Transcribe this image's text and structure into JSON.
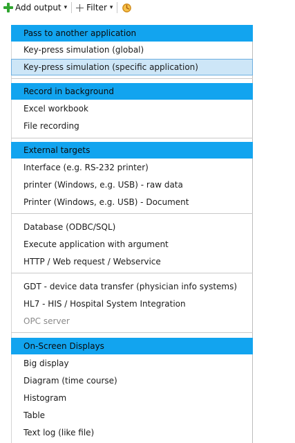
{
  "toolbar": {
    "add_output_label": "Add output",
    "filter_label": "Filter"
  },
  "menu": {
    "items": [
      {
        "label": "Pass to another application",
        "kind": "header"
      },
      {
        "label": "Key-press simulation (global)",
        "kind": "item"
      },
      {
        "label": "Key-press simulation (specific application)",
        "kind": "selected"
      },
      {
        "label": "Record in background",
        "kind": "header"
      },
      {
        "label": "Excel workbook",
        "kind": "item"
      },
      {
        "label": "File recording",
        "kind": "item"
      },
      {
        "label": "External targets",
        "kind": "header"
      },
      {
        "label": "Interface (e.g. RS-232 printer)",
        "kind": "item"
      },
      {
        "label": "printer (Windows, e.g. USB) - raw data",
        "kind": "item"
      },
      {
        "label": "Printer (Windows, e.g. USB) - Document",
        "kind": "item"
      },
      {
        "label": "Database (ODBC/SQL)",
        "kind": "item"
      },
      {
        "label": "Execute application with argument",
        "kind": "item"
      },
      {
        "label": "HTTP / Web request / Webservice",
        "kind": "item"
      },
      {
        "label": "GDT - device data transfer (physician info systems)",
        "kind": "item"
      },
      {
        "label": "HL7 - HIS / Hospital System Integration",
        "kind": "item"
      },
      {
        "label": "OPC server",
        "kind": "disabled"
      },
      {
        "label": "On-Screen Displays",
        "kind": "header"
      },
      {
        "label": "Big display",
        "kind": "item"
      },
      {
        "label": "Diagram (time course)",
        "kind": "item"
      },
      {
        "label": "Histogram",
        "kind": "item"
      },
      {
        "label": "Table",
        "kind": "item"
      },
      {
        "label": "Text log (like file)",
        "kind": "item"
      }
    ]
  },
  "colors": {
    "header_bg": "#12a4ef",
    "selected_bg": "#cde6f7",
    "selected_border": "#6caedf",
    "disabled_text": "#8a8a8a"
  }
}
